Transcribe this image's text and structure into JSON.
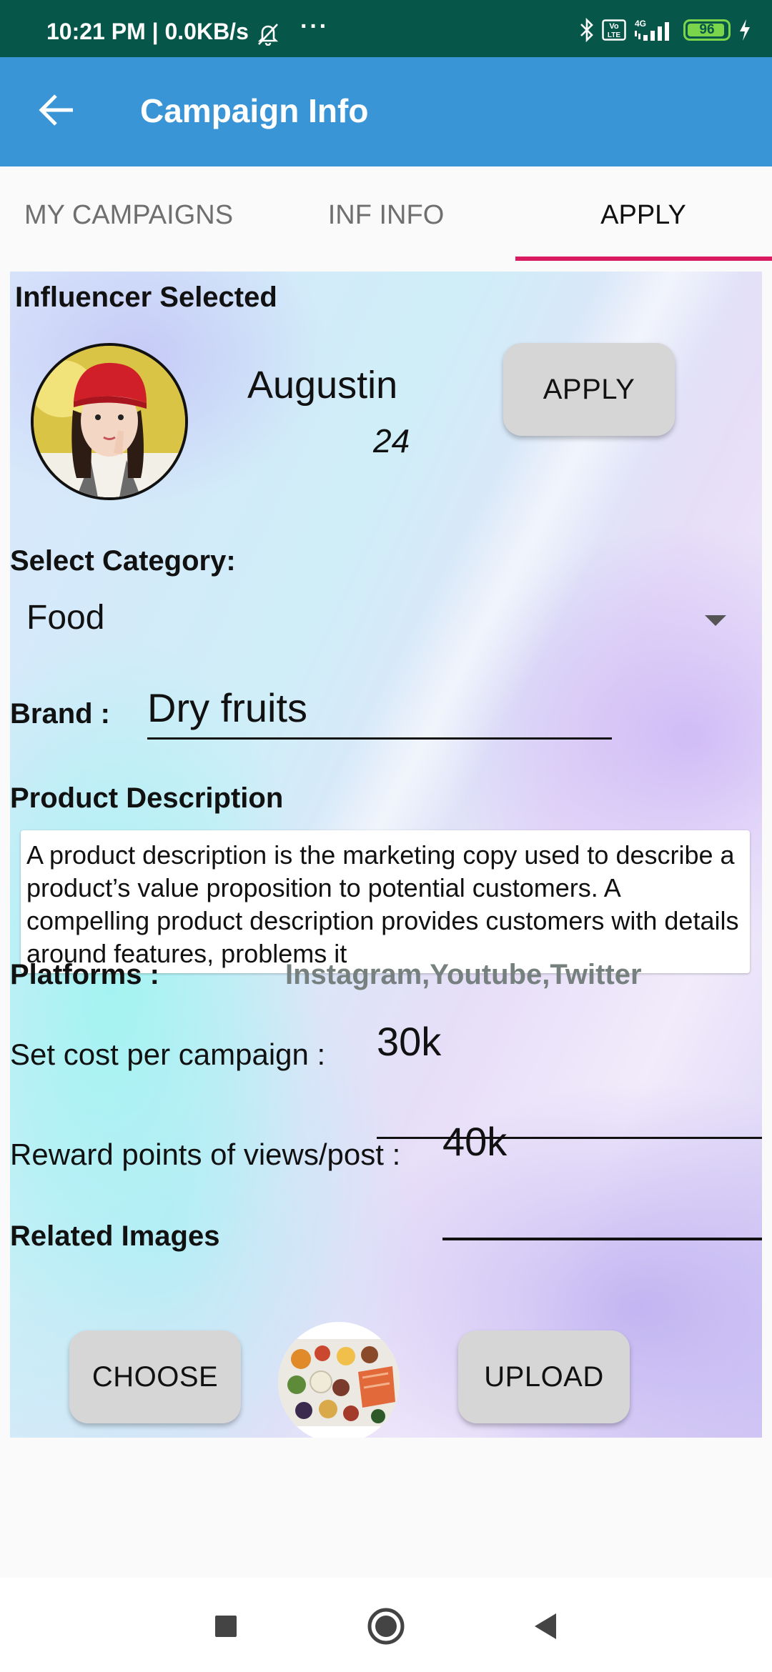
{
  "status_bar": {
    "time_speed": "10:21 PM | 0.0KB/s",
    "more_dots": "···",
    "network": "4G",
    "volte": "Vo LTE",
    "battery": "96"
  },
  "app_bar": {
    "title": "Campaign Info",
    "back_icon": "arrow-left-icon"
  },
  "tabs": [
    {
      "label": "MY CAMPAIGNS",
      "active": false
    },
    {
      "label": "INF INFO",
      "active": false
    },
    {
      "label": "APPLY",
      "active": true
    }
  ],
  "influencer": {
    "section_label": "Influencer Selected",
    "name": "Augustin",
    "age": "24",
    "apply_button": "APPLY"
  },
  "category": {
    "label": "Select Category:",
    "value": "Food"
  },
  "brand": {
    "label": "Brand :",
    "value": "Dry fruits"
  },
  "product_description": {
    "label": "Product Description",
    "text": "A product description is the marketing copy used to describe a product’s value proposition to potential customers. A compelling product description provides customers with details around features, problems it"
  },
  "platforms": {
    "label": "Platforms :",
    "value": "Instagram,Youtube,Twitter"
  },
  "cost": {
    "label": "Set cost per campaign :",
    "value": "30k"
  },
  "reward": {
    "label": "Reward points of views/post :",
    "value": "40k"
  },
  "related_images": {
    "label": "Related Images",
    "choose_button": "CHOOSE",
    "upload_button": "UPLOAD"
  },
  "colors": {
    "status_bar": "#06574a",
    "app_bar": "#3a95d6",
    "tab_indicator": "#d81b60",
    "platforms_text": "#76807f",
    "button_bg": "#d6d6d6"
  }
}
